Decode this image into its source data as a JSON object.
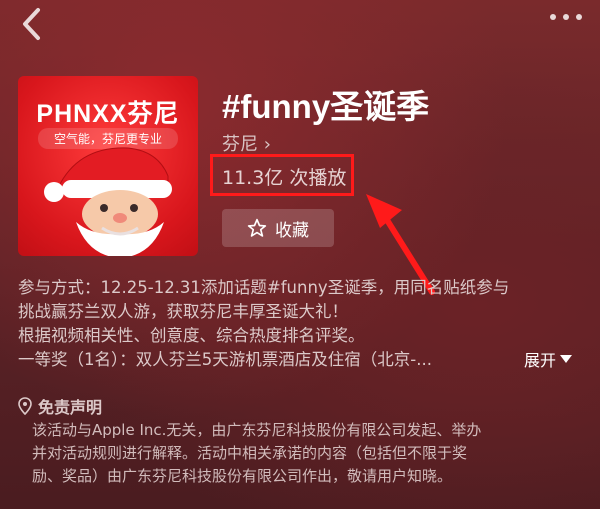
{
  "nav": {
    "back_icon": "chevron-left-icon",
    "more_icon": "more-dots-icon"
  },
  "cover": {
    "brand": "PHNXX芬尼",
    "slogan": "空气能，芬尼更专业",
    "accent": "#d8161c"
  },
  "topic": {
    "title": "#funny圣诞季",
    "author": "芬尼 ›",
    "plays": "11.3亿 次播放",
    "favorite_label": "收藏"
  },
  "description": {
    "lines": [
      "参与方式：12.25-12.31添加话题#funny圣诞季，用同名贴纸参与",
      "挑战赢芬兰双人游，获取芬尼丰厚圣诞大礼！",
      "根据视频相关性、创意度、综合热度排名评奖。",
      "一等奖（1名）：双人芬兰5天游机票酒店及住宿（北京-..."
    ],
    "expand_label": "展开"
  },
  "disclaimer": {
    "title": "免责声明",
    "lines": [
      "该活动与Apple Inc.无关，由广东芬尼科技股份有限公司发起、举办",
      "并对活动规则进行解释。活动中相关承诺的内容（包括但不限于奖",
      "励、奖品）由广东芬尼科技股份有限公司作出，敬请用户知晓。"
    ]
  },
  "annotation": {
    "highlight_color": "#ff1a1a"
  }
}
